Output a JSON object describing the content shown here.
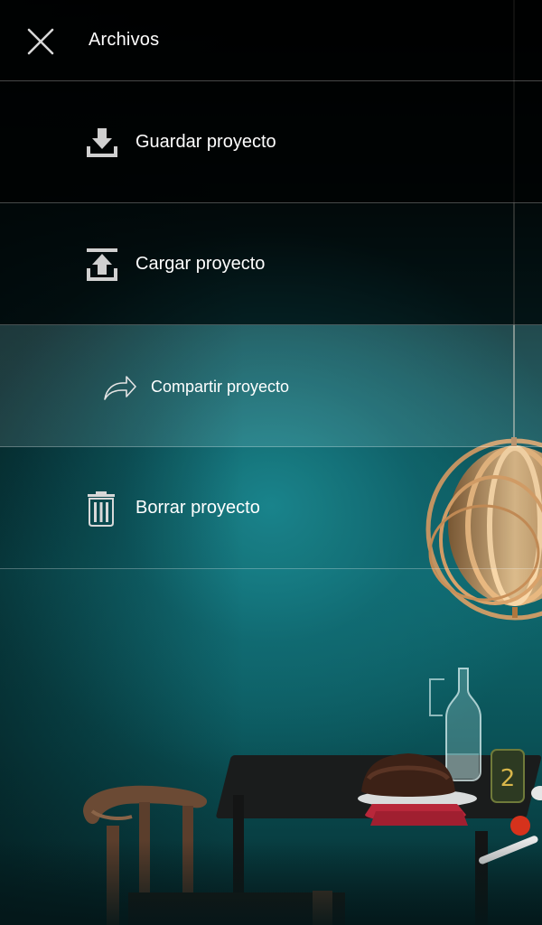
{
  "header": {
    "title": "Archivos",
    "close_icon": "close-icon"
  },
  "menu": {
    "items": [
      {
        "label": "Guardar proyecto",
        "icon": "download-icon"
      },
      {
        "label": "Cargar proyecto",
        "icon": "upload-icon"
      },
      {
        "label": "Compartir proyecto",
        "icon": "share-icon",
        "highlighted": true
      },
      {
        "label": "Borrar proyecto",
        "icon": "trash-icon"
      }
    ]
  },
  "background": {
    "jar_label": "2",
    "wall_color": "#0f6a70"
  }
}
